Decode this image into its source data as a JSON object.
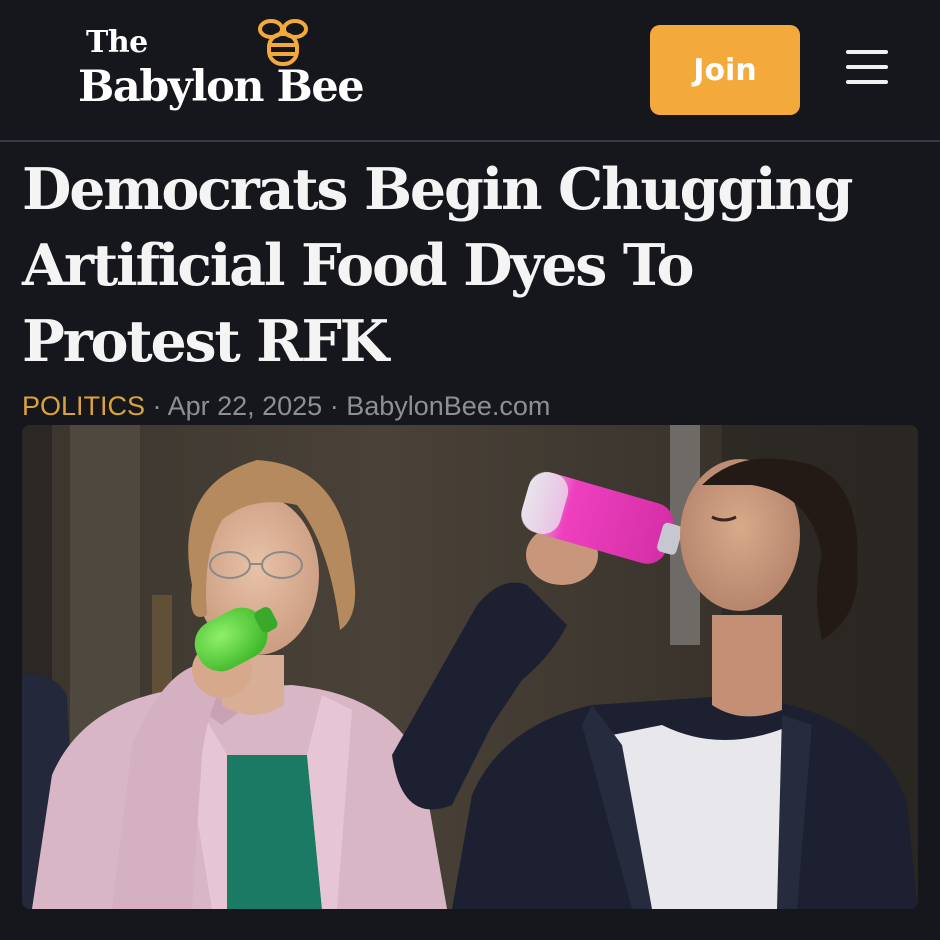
{
  "header": {
    "logo_line1": "The",
    "logo_line2": "Babylon Bee",
    "join_label": "Join",
    "menu_icon": "hamburger-menu-icon",
    "logo_icon": "bee-icon"
  },
  "article": {
    "headline": "Democrats Begin Chugging Artificial Food Dyes To Protest RFK",
    "category": "POLITICS",
    "separator": "·",
    "date": "Apr 22, 2025",
    "source": "BabylonBee.com"
  },
  "colors": {
    "background": "#16171c",
    "join_button": "#f4a93b",
    "category": "#d9a23b",
    "meta": "#8e8f95",
    "headline": "#f4f4f4"
  }
}
